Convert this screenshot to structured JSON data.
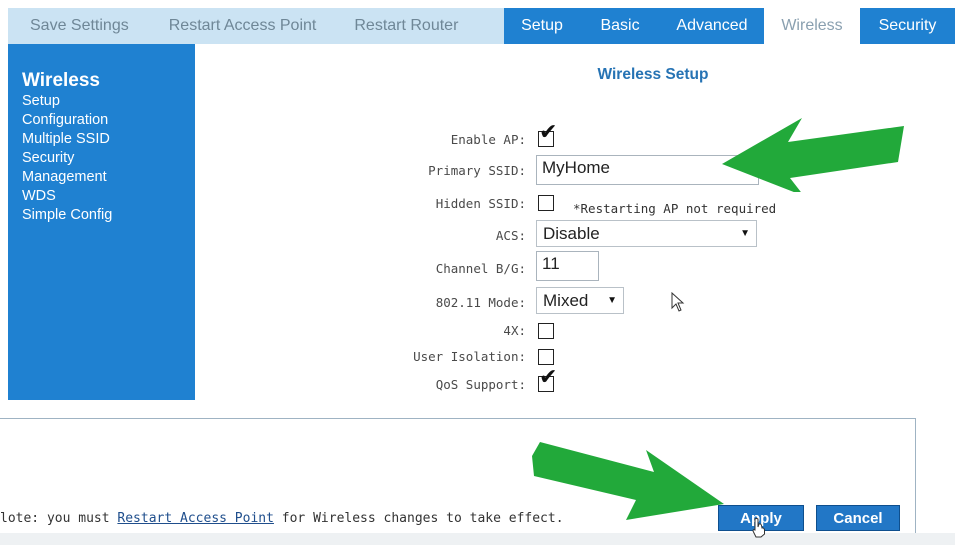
{
  "top_links": [
    "Save Settings",
    "Restart Access Point",
    "Restart Router"
  ],
  "tabs": [
    {
      "label": "Setup",
      "active": false
    },
    {
      "label": "Basic",
      "active": false
    },
    {
      "label": "Advanced",
      "active": false
    },
    {
      "label": "Wireless",
      "active": true
    },
    {
      "label": "Security",
      "active": false
    }
  ],
  "sidebar": {
    "title": "Wireless",
    "items": [
      "Setup",
      "Configuration",
      "Multiple SSID",
      "Security",
      "Management",
      "WDS",
      "Simple Config"
    ]
  },
  "main": {
    "title": "Wireless Setup",
    "fields": {
      "enable_ap": {
        "label": "Enable AP:",
        "checked": true
      },
      "primary_ssid": {
        "label": "Primary SSID:",
        "value": "MyHome"
      },
      "hidden_ssid": {
        "label": "Hidden SSID:",
        "checked": false,
        "hint": "*Restarting AP not required"
      },
      "acs": {
        "label": "ACS:",
        "value": "Disable"
      },
      "channel": {
        "label": "Channel B/G:",
        "value": "11"
      },
      "mode": {
        "label": "802.11 Mode:",
        "value": "Mixed"
      },
      "fourx": {
        "label": "4X:",
        "checked": false
      },
      "user_isolation": {
        "label": "User Isolation:",
        "checked": false
      },
      "qos": {
        "label": "QoS Support:",
        "checked": true
      }
    }
  },
  "footer": {
    "note_prefix": "lote: you must ",
    "note_link": "Restart Access Point",
    "note_suffix": " for Wireless changes to take effect.",
    "apply_label": "Apply",
    "cancel_label": "Cancel"
  },
  "colors": {
    "accent_blue": "#1f81d1",
    "arrow_green": "#22a93a",
    "header_light": "#cbe3f3"
  }
}
